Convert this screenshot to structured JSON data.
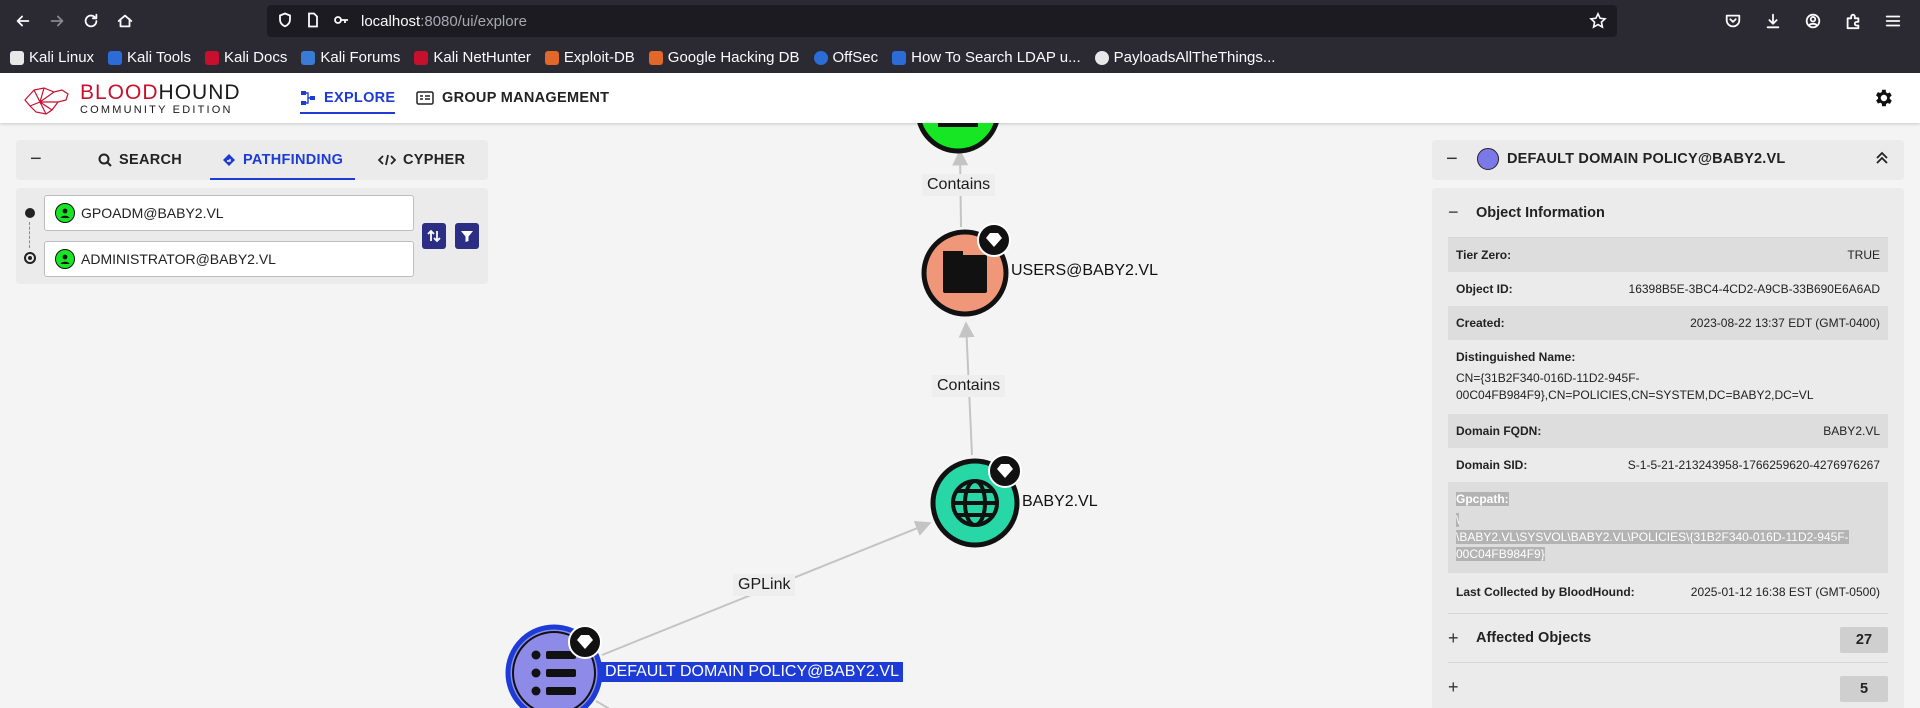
{
  "browser": {
    "url_host": "localhost",
    "url_path": ":8080/ui/explore",
    "bookmarks": [
      {
        "label": "Kali Linux",
        "color": "#e8e8e8"
      },
      {
        "label": "Kali Tools",
        "color": "#2b6cd8"
      },
      {
        "label": "Kali Docs",
        "color": "#c8102e"
      },
      {
        "label": "Kali Forums",
        "color": "#3a7bd5"
      },
      {
        "label": "Kali NetHunter",
        "color": "#c8102e"
      },
      {
        "label": "Exploit-DB",
        "color": "#e2672b"
      },
      {
        "label": "Google Hacking DB",
        "color": "#e2672b"
      },
      {
        "label": "OffSec",
        "color": "#2b6cd8"
      },
      {
        "label": "How To Search LDAP u...",
        "color": "#2b6cd8"
      },
      {
        "label": "PayloadsAllTheThings...",
        "color": "#e8e8e8"
      }
    ]
  },
  "app": {
    "logo_line1_a": "BLOOD",
    "logo_line1_b": "HOUND",
    "logo_line2": "COMMUNITY EDITION",
    "tabs": {
      "explore": "EXPLORE",
      "group": "GROUP MANAGEMENT"
    }
  },
  "left_panel": {
    "tabs": {
      "search": "SEARCH",
      "pathfinding": "PATHFINDING",
      "cypher": "CYPHER"
    },
    "start_node": "GPOADM@BABY2.VL",
    "end_node": "ADMINISTRATOR@BABY2.VL"
  },
  "graph": {
    "nodes": {
      "users": "USERS@BABY2.VL",
      "domain": "BABY2.VL",
      "gpo": "DEFAULT DOMAIN POLICY@BABY2.VL"
    },
    "edges": {
      "contains_top": "Contains",
      "contains_mid": "Contains",
      "gplink": "GPLink"
    },
    "colors": {
      "group_node": "#f0977a",
      "domain_node": "#27d8a6",
      "gpo_node": "#8e8be8",
      "user_node": "#17e625"
    }
  },
  "right_panel": {
    "title": "DEFAULT DOMAIN POLICY@BABY2.VL",
    "object_info_title": "Object Information",
    "rows": {
      "tier_zero_k": "Tier Zero:",
      "tier_zero_v": "TRUE",
      "object_id_k": "Object ID:",
      "object_id_v": "16398B5E-3BC4-4CD2-A9CB-33B690E6A6AD",
      "created_k": "Created:",
      "created_v": "2023-08-22 13:37 EDT (GMT-0400)",
      "dn_k": "Distinguished Name:",
      "dn_v1": "CN={31B2F340-016D-11D2-945F-",
      "dn_v2": "00C04FB984F9},CN=POLICIES,CN=SYSTEM,DC=BABY2,DC=VL",
      "fqdn_k": "Domain FQDN:",
      "fqdn_v": "BABY2.VL",
      "sid_k": "Domain SID:",
      "sid_v": "S-1-5-21-213243958-1766259620-4276976267",
      "gpc_k": "Gpcpath:",
      "gpc_v1": "\\",
      "gpc_v2": "\\BABY2.VL\\SYSVOL\\BABY2.VL\\POLICIES\\{31B2F340-016D-11D2-945F-",
      "gpc_v3": "00C04FB984F9}",
      "last_k": "Last Collected by BloodHound:",
      "last_v": "2025-01-12 16:38 EST (GMT-0500)"
    },
    "affected_title": "Affected Objects",
    "affected_count": "27",
    "next_count": "5"
  }
}
